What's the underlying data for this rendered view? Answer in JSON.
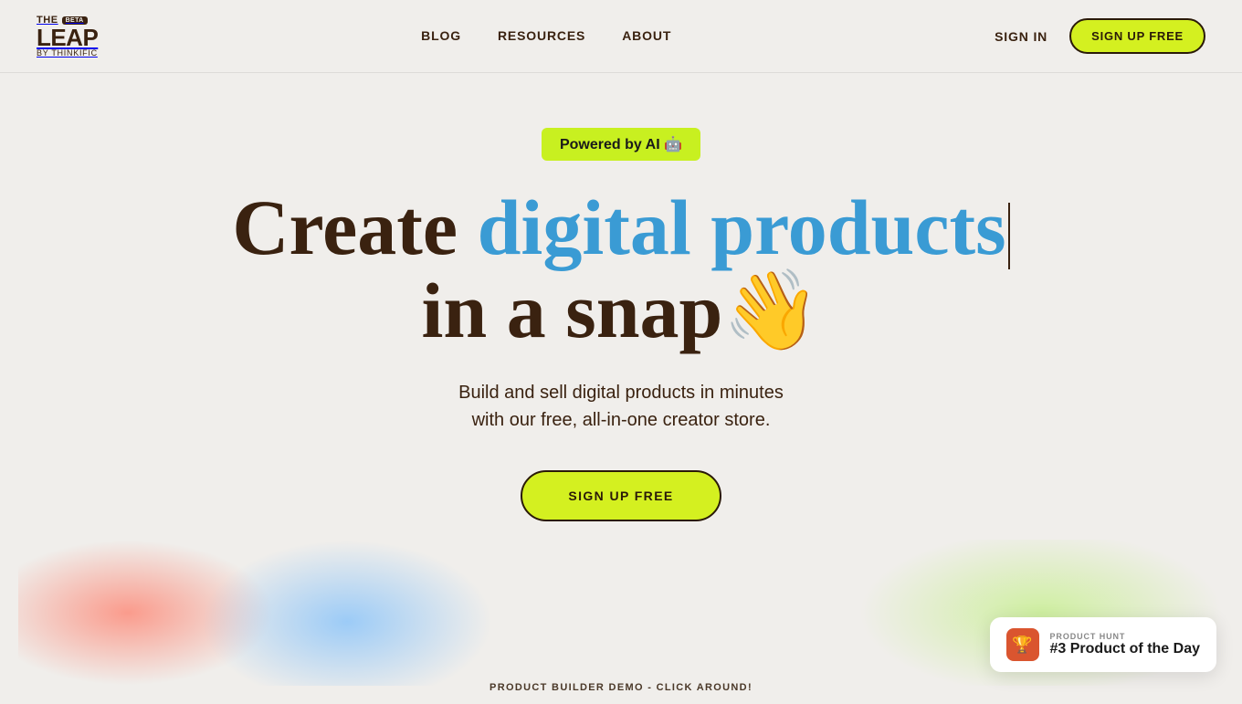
{
  "nav": {
    "logo": {
      "the": "THE",
      "beta": "BETA",
      "leap": "LEAP",
      "by": "BY THINKIFIC"
    },
    "links": [
      {
        "label": "BLOG",
        "href": "#"
      },
      {
        "label": "RESOURCES",
        "href": "#"
      },
      {
        "label": "ABOUT",
        "href": "#"
      }
    ],
    "sign_in_label": "SIGN IN",
    "sign_up_label": "SIGN UP FREE"
  },
  "hero": {
    "powered_badge": "Powered by AI 🤖",
    "headline_part1": "Create ",
    "headline_highlight": "digital products",
    "headline_part2": "in a snap👋",
    "subtext_line1": "Build and sell digital products in minutes",
    "subtext_line2": "with our free, all-in-one creator store.",
    "cta_label": "SIGN UP FREE"
  },
  "bottom_bar": {
    "demo_text": "PRODUCT BUILDER DEMO - CLICK AROUND!"
  },
  "product_hunt": {
    "label": "PRODUCT HUNT",
    "title": "#3 Product of the Day"
  }
}
